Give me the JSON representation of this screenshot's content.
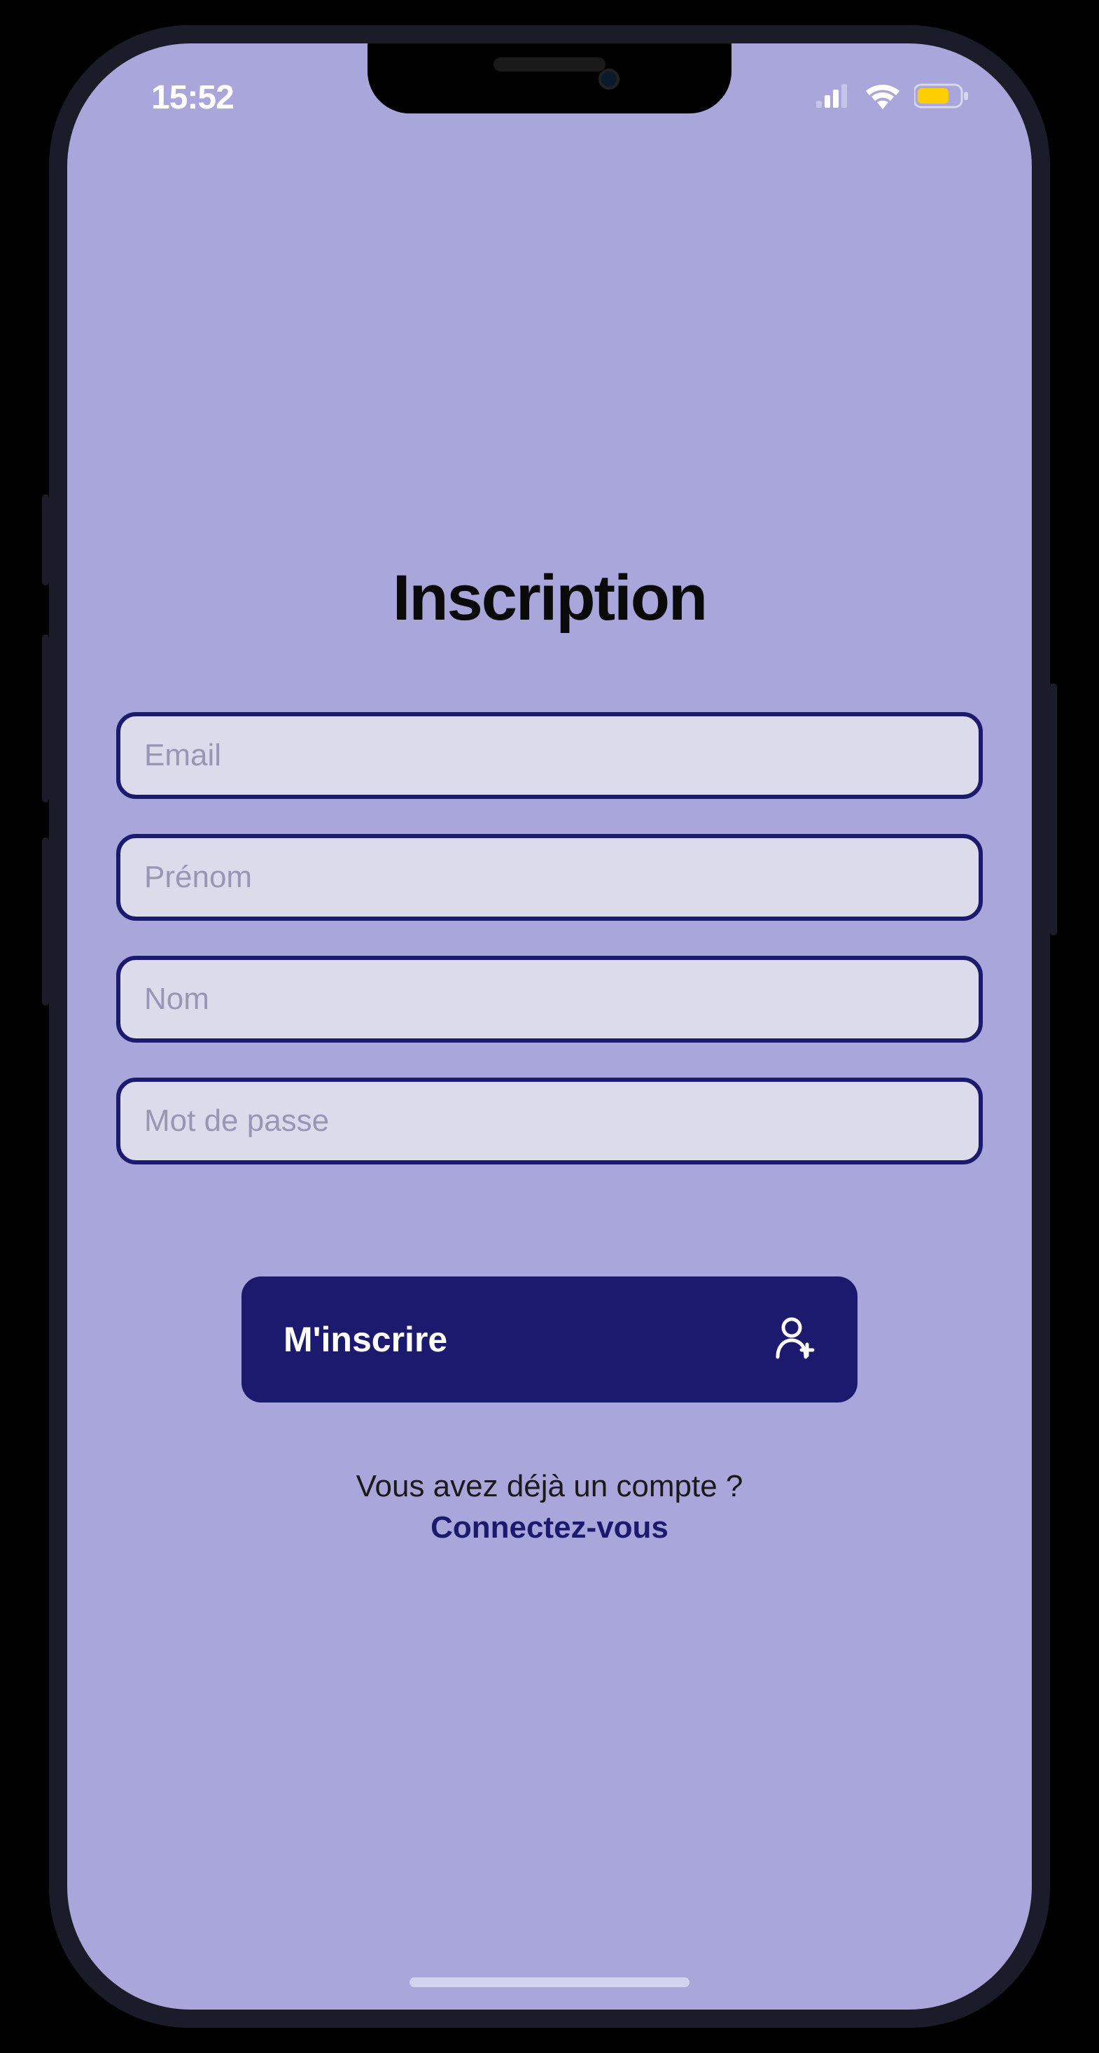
{
  "status_bar": {
    "time": "15:52"
  },
  "page": {
    "title": "Inscription"
  },
  "form": {
    "email_placeholder": "Email",
    "firstname_placeholder": "Prénom",
    "lastname_placeholder": "Nom",
    "password_placeholder": "Mot de passe",
    "submit_label": "M'inscrire"
  },
  "footer": {
    "question": "Vous avez déjà un compte ?",
    "link_label": "Connectez-vous"
  }
}
